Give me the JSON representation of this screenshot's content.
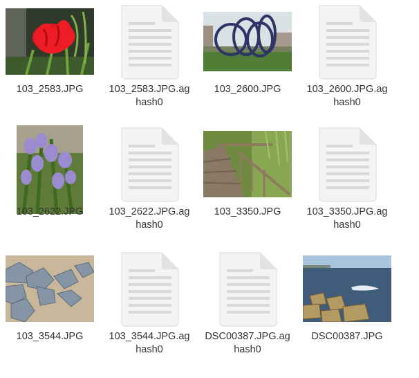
{
  "files": [
    {
      "name": "103_2583.JPG",
      "type": "image",
      "subject": "red-tulip"
    },
    {
      "name": "103_2583.JPG.ag\nhash0",
      "type": "generic-document"
    },
    {
      "name": "103_2600.JPG",
      "type": "image",
      "subject": "blue-loop-sculpture"
    },
    {
      "name": "103_2600.JPG.ag\nhash0",
      "type": "generic-document"
    },
    {
      "name": "103_2622.JPG",
      "type": "image",
      "subject": "bluebells"
    },
    {
      "name": "103_2622.JPG.ag\nhash0",
      "type": "generic-document"
    },
    {
      "name": "103_3350.JPG",
      "type": "image",
      "subject": "wooden-boardwalk"
    },
    {
      "name": "103_3350.JPG.ag\nhash0",
      "type": "generic-document"
    },
    {
      "name": "103_3544.JPG",
      "type": "image",
      "subject": "rocks"
    },
    {
      "name": "103_3544.JPG.ag\nhash0",
      "type": "generic-document"
    },
    {
      "name": "DSC00387.JPG.ag\nhash0",
      "type": "generic-document"
    },
    {
      "name": "DSC00387.JPG",
      "type": "image",
      "subject": "seashore"
    }
  ]
}
